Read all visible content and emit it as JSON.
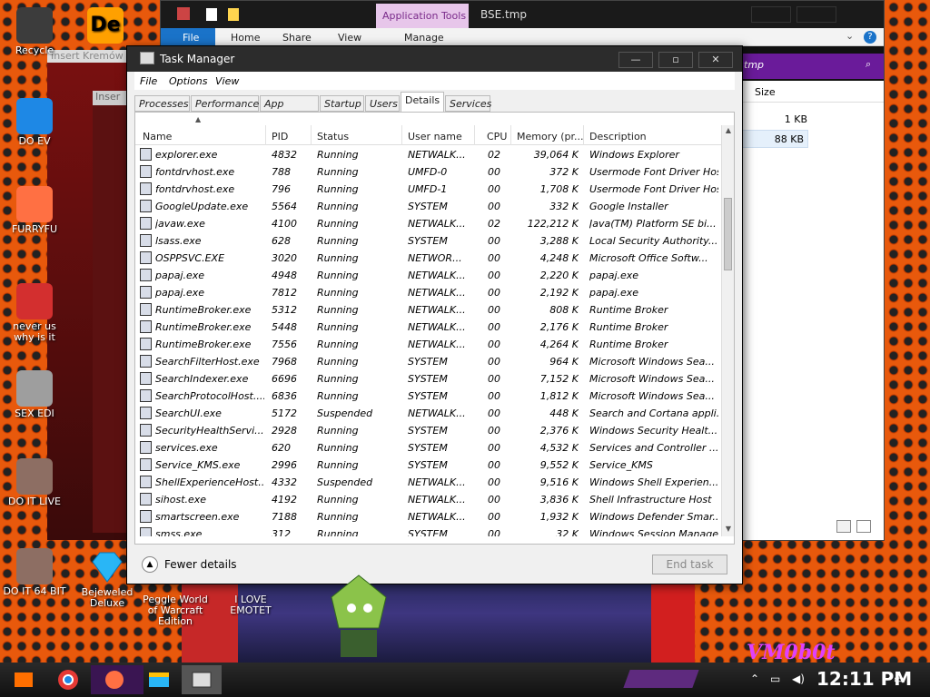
{
  "desktop": {
    "icons": [
      {
        "label": "Recycle",
        "color": "#3c3c3c"
      },
      {
        "label": "DO EV",
        "color": "#1e88e5"
      },
      {
        "label": "FURRYFU",
        "color": "#ff7043"
      },
      {
        "label": "never us why is it",
        "color": "#d32f2f"
      },
      {
        "label": "SEX EDI",
        "color": "#9e9e9e"
      },
      {
        "label": "DO IT LIVE",
        "color": "#8d6e63"
      },
      {
        "label": "DO IT 64 BIT",
        "color": "#8d6e63"
      }
    ],
    "icon_de": {
      "label": "De",
      "color": "#ffa000"
    },
    "bejeweled": {
      "label": "Bejeweled Deluxe",
      "color": "#29b6f6"
    },
    "peggle": {
      "label": "Peggle World of Warcraft Edition"
    },
    "emotet": {
      "label": "I LOVE EMOTET"
    },
    "insert1": "Insert Kremów",
    "insert2": "Inser",
    "watermark": "VM0b0t"
  },
  "explorer": {
    "title": "BSE.tmp",
    "app_tools": "Application Tools",
    "ribbon": {
      "file": "File",
      "home": "Home",
      "share": "Share",
      "view": "View",
      "manage": "Manage"
    },
    "search_text": "tmp",
    "size_header": "Size",
    "sizes": [
      "1 KB",
      "88 KB"
    ]
  },
  "taskmanager": {
    "title": "Task Manager",
    "menu": {
      "file": "File",
      "options": "Options",
      "view": "View"
    },
    "tabs": [
      "Processes",
      "Performance",
      "App history",
      "Startup",
      "Users",
      "Details",
      "Services"
    ],
    "active_tab": "Details",
    "columns": {
      "name": "Name",
      "pid": "PID",
      "status": "Status",
      "user": "User name",
      "cpu": "CPU",
      "memory": "Memory (pr...",
      "desc": "Description"
    },
    "rows": [
      {
        "name": "explorer.exe",
        "pid": "4832",
        "status": "Running",
        "user": "NETWALK...",
        "cpu": "02",
        "mem": "39,064 K",
        "desc": "Windows Explorer"
      },
      {
        "name": "fontdrvhost.exe",
        "pid": "788",
        "status": "Running",
        "user": "UMFD-0",
        "cpu": "00",
        "mem": "372 K",
        "desc": "Usermode Font Driver Host"
      },
      {
        "name": "fontdrvhost.exe",
        "pid": "796",
        "status": "Running",
        "user": "UMFD-1",
        "cpu": "00",
        "mem": "1,708 K",
        "desc": "Usermode Font Driver Host"
      },
      {
        "name": "GoogleUpdate.exe",
        "pid": "5564",
        "status": "Running",
        "user": "SYSTEM",
        "cpu": "00",
        "mem": "332 K",
        "desc": "Google Installer"
      },
      {
        "name": "javaw.exe",
        "pid": "4100",
        "status": "Running",
        "user": "NETWALK...",
        "cpu": "02",
        "mem": "122,212 K",
        "desc": "Java(TM) Platform SE bi..."
      },
      {
        "name": "lsass.exe",
        "pid": "628",
        "status": "Running",
        "user": "SYSTEM",
        "cpu": "00",
        "mem": "3,288 K",
        "desc": "Local Security Authority..."
      },
      {
        "name": "OSPPSVC.EXE",
        "pid": "3020",
        "status": "Running",
        "user": "NETWOR...",
        "cpu": "00",
        "mem": "4,248 K",
        "desc": "Microsoft Office Softw..."
      },
      {
        "name": "papaj.exe",
        "pid": "4948",
        "status": "Running",
        "user": "NETWALK...",
        "cpu": "00",
        "mem": "2,220 K",
        "desc": "papaj.exe"
      },
      {
        "name": "papaj.exe",
        "pid": "7812",
        "status": "Running",
        "user": "NETWALK...",
        "cpu": "00",
        "mem": "2,192 K",
        "desc": "papaj.exe"
      },
      {
        "name": "RuntimeBroker.exe",
        "pid": "5312",
        "status": "Running",
        "user": "NETWALK...",
        "cpu": "00",
        "mem": "808 K",
        "desc": "Runtime Broker"
      },
      {
        "name": "RuntimeBroker.exe",
        "pid": "5448",
        "status": "Running",
        "user": "NETWALK...",
        "cpu": "00",
        "mem": "2,176 K",
        "desc": "Runtime Broker"
      },
      {
        "name": "RuntimeBroker.exe",
        "pid": "7556",
        "status": "Running",
        "user": "NETWALK...",
        "cpu": "00",
        "mem": "4,264 K",
        "desc": "Runtime Broker"
      },
      {
        "name": "SearchFilterHost.exe",
        "pid": "7968",
        "status": "Running",
        "user": "SYSTEM",
        "cpu": "00",
        "mem": "964 K",
        "desc": "Microsoft Windows Sea..."
      },
      {
        "name": "SearchIndexer.exe",
        "pid": "6696",
        "status": "Running",
        "user": "SYSTEM",
        "cpu": "00",
        "mem": "7,152 K",
        "desc": "Microsoft Windows Sea..."
      },
      {
        "name": "SearchProtocolHost....",
        "pid": "6836",
        "status": "Running",
        "user": "SYSTEM",
        "cpu": "00",
        "mem": "1,812 K",
        "desc": "Microsoft Windows Sea..."
      },
      {
        "name": "SearchUI.exe",
        "pid": "5172",
        "status": "Suspended",
        "user": "NETWALK...",
        "cpu": "00",
        "mem": "448 K",
        "desc": "Search and Cortana appli..."
      },
      {
        "name": "SecurityHealthServi...",
        "pid": "2928",
        "status": "Running",
        "user": "SYSTEM",
        "cpu": "00",
        "mem": "2,376 K",
        "desc": "Windows Security Healt..."
      },
      {
        "name": "services.exe",
        "pid": "620",
        "status": "Running",
        "user": "SYSTEM",
        "cpu": "00",
        "mem": "4,532 K",
        "desc": "Services and Controller ..."
      },
      {
        "name": "Service_KMS.exe",
        "pid": "2996",
        "status": "Running",
        "user": "SYSTEM",
        "cpu": "00",
        "mem": "9,552 K",
        "desc": "Service_KMS"
      },
      {
        "name": "ShellExperienceHost...",
        "pid": "4332",
        "status": "Suspended",
        "user": "NETWALK...",
        "cpu": "00",
        "mem": "9,516 K",
        "desc": "Windows Shell Experien..."
      },
      {
        "name": "sihost.exe",
        "pid": "4192",
        "status": "Running",
        "user": "NETWALK...",
        "cpu": "00",
        "mem": "3,836 K",
        "desc": "Shell Infrastructure Host"
      },
      {
        "name": "smartscreen.exe",
        "pid": "7188",
        "status": "Running",
        "user": "NETWALK...",
        "cpu": "00",
        "mem": "1,932 K",
        "desc": "Windows Defender Smar..."
      },
      {
        "name": "smss.exe",
        "pid": "312",
        "status": "Running",
        "user": "SYSTEM",
        "cpu": "00",
        "mem": "32 K",
        "desc": "Windows Session Manager"
      }
    ],
    "fewer_details": "Fewer details",
    "end_task": "End task"
  },
  "taskbar": {
    "clock": "12:11 PM"
  }
}
